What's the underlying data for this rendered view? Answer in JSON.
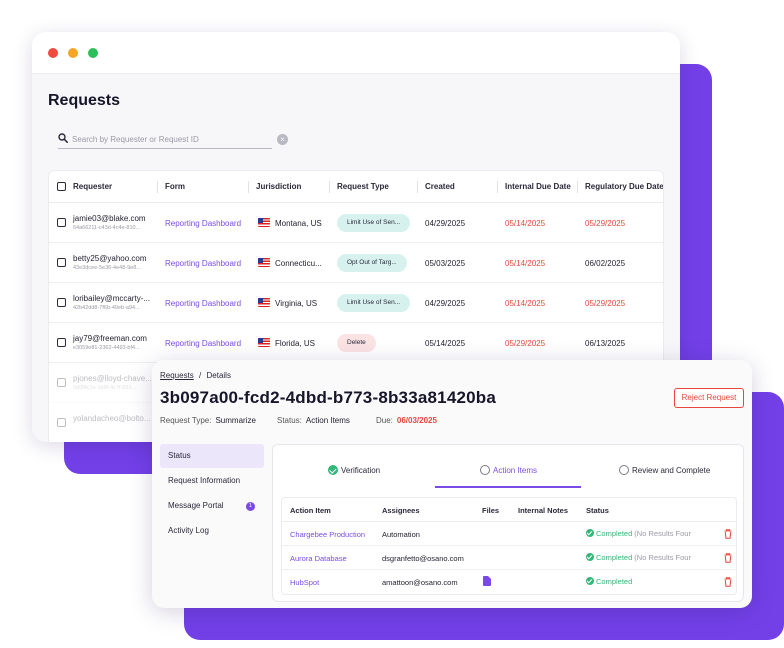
{
  "colors": {
    "brand": "#7b4ae6",
    "backdrop": "#7340e8",
    "danger": "#e8453c",
    "success": "#35b77a"
  },
  "list_window": {
    "page_title": "Requests",
    "search": {
      "placeholder": "Search by Requester or Request ID",
      "value": ""
    },
    "columns": [
      "Requester",
      "Form",
      "Jurisdiction",
      "Request Type",
      "Created",
      "Internal Due Date",
      "Regulatory Due Date"
    ],
    "rows": [
      {
        "email": "jamie03@blake.com",
        "id": "64a66211-c43d-4c4e-810...",
        "form": "Reporting Dashboard",
        "jurisdiction": "Montana, US",
        "type": "Limit Use of Sen...",
        "created": "04/29/2025",
        "internal_due": "05/14/2025",
        "regulatory_due": "05/29/2025"
      },
      {
        "email": "betty25@yahoo.com",
        "id": "43e3dcee-5e36-4e48-9e8...",
        "form": "Reporting Dashboard",
        "jurisdiction": "Connecticu...",
        "type": "Opt Out of Targ...",
        "created": "05/03/2025",
        "internal_due": "05/14/2025",
        "regulatory_due": "06/02/2025"
      },
      {
        "email": "loribailey@mccarty-...",
        "id": "42b42dd8-7f6b-49eb-a94...",
        "form": "Reporting Dashboard",
        "jurisdiction": "Virginia, US",
        "type": "Limit Use of Sen...",
        "created": "04/29/2025",
        "internal_due": "05/14/2025",
        "regulatory_due": "05/29/2025"
      },
      {
        "email": "jay79@freeman.com",
        "id": "e3059e81-2362-4493-bf4...",
        "form": "Reporting Dashboard",
        "jurisdiction": "Florida, US",
        "type": "Delete",
        "created": "05/14/2025",
        "internal_due": "05/29/2025",
        "regulatory_due": "06/13/2025"
      },
      {
        "email": "pjones@lloyd-chave...",
        "id": "6d0f4c1e-1a9f-4c7f-833..."
      },
      {
        "email": "yolandacheo@bolto..."
      }
    ]
  },
  "detail_window": {
    "breadcrumb": {
      "root": "Requests",
      "separator": "/",
      "current": "Details"
    },
    "request_id": "3b097a00-fcd2-4dbd-b773-8b33a81420ba",
    "request_type_label": "Request Type:",
    "request_type_value": "Summarize",
    "status_label": "Status:",
    "status_value": "Action Items",
    "due_label": "Due:",
    "due_value": "06/03/2025",
    "reject_button": "Reject Request",
    "nav": [
      {
        "label": "Status"
      },
      {
        "label": "Request Information"
      },
      {
        "label": "Message Portal",
        "badge": "1"
      },
      {
        "label": "Activity Log"
      }
    ],
    "steps": [
      "Verification",
      "Action Items",
      "Review and Complete"
    ],
    "table_columns": [
      "Action Item",
      "Assignees",
      "Files",
      "Internal Notes",
      "Status"
    ],
    "items": [
      {
        "name": "Chargebee Production",
        "assignee": "Automation",
        "status": "Completed",
        "note": "(No Results Four"
      },
      {
        "name": "Aurora Database",
        "assignee": "dsgranfetto@osano.com",
        "status": "Completed",
        "note": "(No Results Four"
      },
      {
        "name": "HubSpot",
        "assignee": "amattoon@osano.com",
        "status": "Completed",
        "note": ""
      }
    ]
  }
}
